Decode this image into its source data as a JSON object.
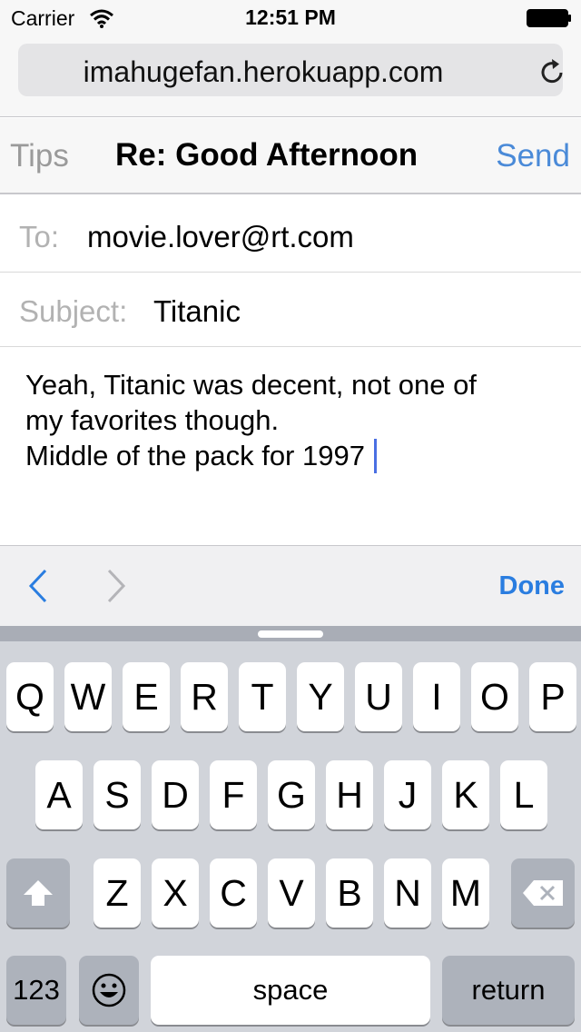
{
  "status_bar": {
    "carrier": "Carrier",
    "time": "12:51 PM"
  },
  "browser": {
    "url": "imahugefan.herokuapp.com"
  },
  "nav": {
    "back_label": "Tips",
    "title": "Re: Good Afternoon",
    "send_label": "Send"
  },
  "compose": {
    "to_label": "To:",
    "to_value": "movie.lover@rt.com",
    "subject_label": "Subject:",
    "subject_value": "Titanic",
    "body_lines": [
      "Yeah, Titanic was decent, not one of",
      "my favorites though.",
      "Middle of the pack for 1997"
    ]
  },
  "accessory": {
    "done_label": "Done"
  },
  "keyboard": {
    "row1": [
      "Q",
      "W",
      "E",
      "R",
      "T",
      "Y",
      "U",
      "I",
      "O",
      "P"
    ],
    "row2": [
      "A",
      "S",
      "D",
      "F",
      "G",
      "H",
      "J",
      "K",
      "L"
    ],
    "row3": [
      "Z",
      "X",
      "C",
      "V",
      "B",
      "N",
      "M"
    ],
    "numbers_label": "123",
    "space_label": "space",
    "return_label": "return"
  },
  "colors": {
    "accent": "#4a8ad8",
    "done": "#2a7de0",
    "caret": "#4a6fe3",
    "keyboard_bg": "#d1d4da"
  }
}
